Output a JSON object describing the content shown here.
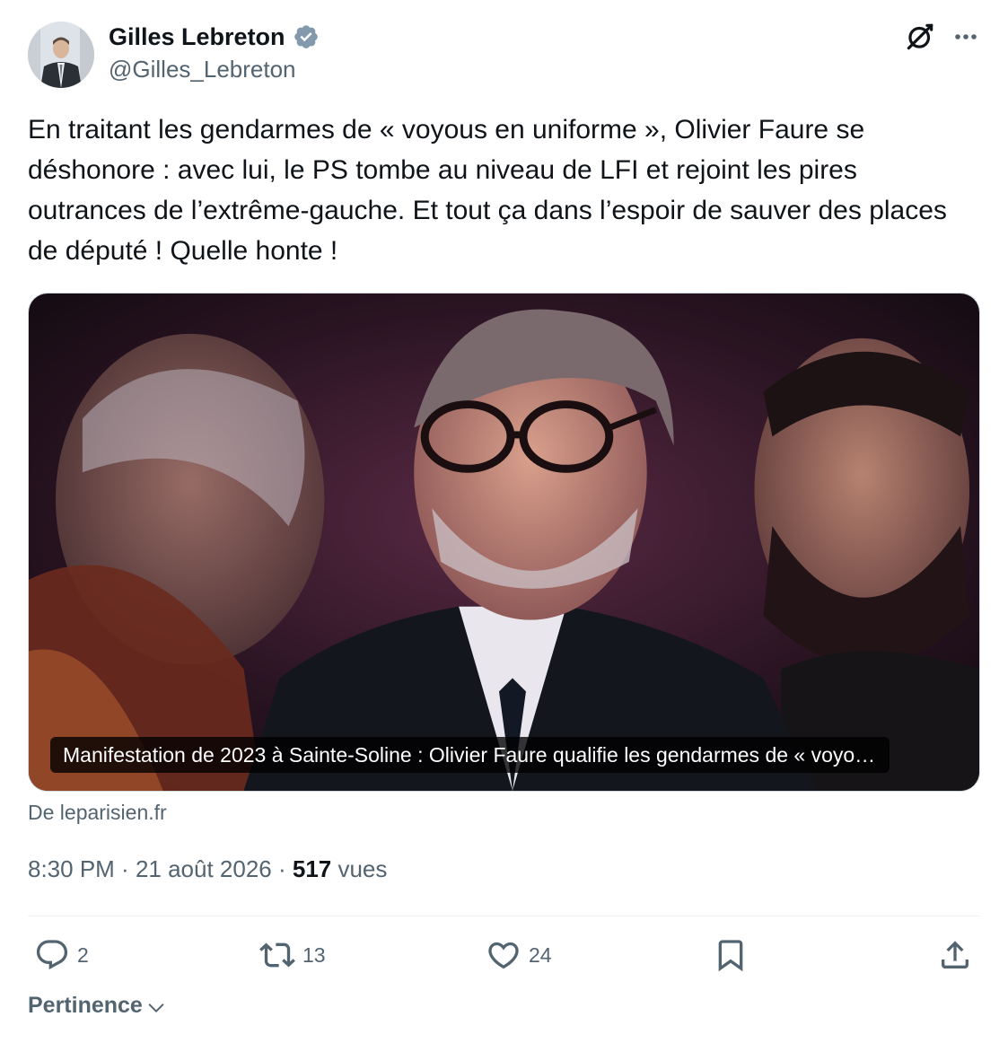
{
  "author": {
    "display_name": "Gilles Lebreton",
    "handle": "@Gilles_Lebreton",
    "verified": true,
    "verified_color": "#829aab"
  },
  "tweet": {
    "text": "En traitant les gendarmes de « voyous en uniforme », Olivier Faure se déshonore : avec lui, le PS tombe au niveau de LFI et rejoint les pires outrances de l’extrême-gauche. Et tout ça dans l’espoir de sauver des places de député ! Quelle honte !"
  },
  "card": {
    "caption": "Manifestation de 2023 à Sainte-Soline : Olivier Faure qualifie les gendarmes de « voyo…",
    "source": "De leparisien.fr"
  },
  "meta": {
    "time": "8:30 PM",
    "separator": " · ",
    "date": "21 août 2026",
    "views_count": "517",
    "views_label": " vues"
  },
  "actions": {
    "replies": "2",
    "reposts": "13",
    "likes": "24"
  },
  "sort": {
    "label": "Pertinence"
  },
  "icons": {
    "header_right": [
      "grok-icon",
      "more-icon"
    ],
    "actions": [
      "reply-icon",
      "repost-icon",
      "like-icon",
      "bookmark-icon",
      "share-icon"
    ],
    "icon_color": "#536471"
  }
}
